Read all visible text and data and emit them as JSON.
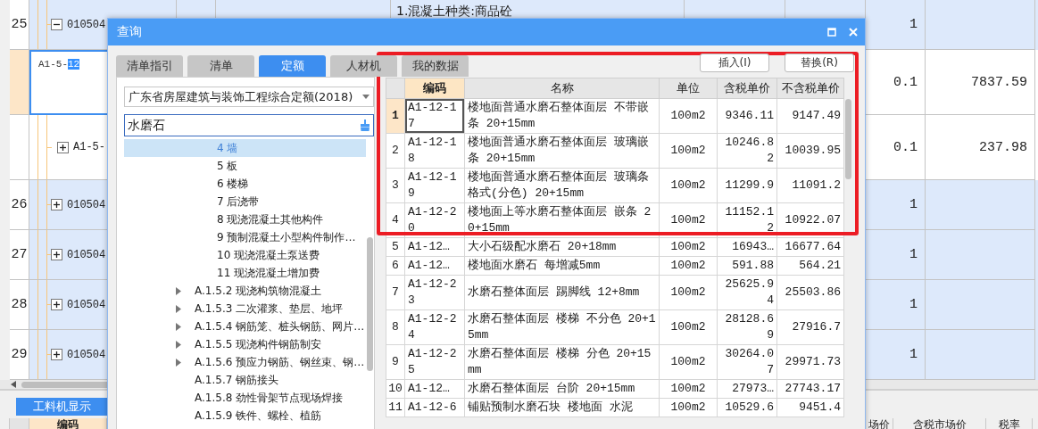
{
  "sheet": {
    "rows": [
      {
        "kind": "group",
        "index": "25",
        "expanded": true,
        "code": "010504",
        "description": "1.混凝土种类:商品砼",
        "quantity": "1",
        "selected": false
      },
      {
        "kind": "editing",
        "code": "A1-5-",
        "code_selection": "12",
        "quantity": "0.1",
        "amount": "7837.59",
        "selected": true
      },
      {
        "kind": "item",
        "expanded": false,
        "code": "A1-5-",
        "quantity": "0.1",
        "amount": "237.98",
        "selected": false
      },
      {
        "kind": "group",
        "index": "26",
        "expanded": false,
        "code": "010504",
        "quantity": "1",
        "selected": false
      },
      {
        "kind": "group",
        "index": "27",
        "expanded": false,
        "code": "010504",
        "quantity": "1",
        "selected": false
      },
      {
        "kind": "group",
        "index": "28",
        "expanded": false,
        "code": "010504",
        "quantity": "1",
        "selected": false
      },
      {
        "kind": "group",
        "index": "29",
        "expanded": false,
        "code": "010504",
        "quantity": "1",
        "selected": false
      }
    ]
  },
  "detail_panel": {
    "button": "工料机显示",
    "columns": [
      {
        "label": "编码"
      },
      {
        "label": "场价"
      },
      {
        "label": "含税市场价"
      },
      {
        "label": "税率"
      }
    ]
  },
  "dialog": {
    "title": "查询",
    "tabs": [
      {
        "label": "清单指引",
        "selected": false
      },
      {
        "label": "清单",
        "selected": false
      },
      {
        "label": "定额",
        "selected": true
      },
      {
        "label": "人材机",
        "selected": false
      },
      {
        "label": "我的数据",
        "selected": false
      }
    ],
    "buttons": [
      "插入(I)",
      "替换(R)"
    ],
    "library": "广东省房屋建筑与装饰工程综合定额(2018)",
    "search": "水磨石",
    "tree": [
      {
        "children": [
          {
            "label": "4 墙",
            "expandable": false,
            "selected": true
          },
          {
            "label": "5 板",
            "expandable": false,
            "selected": false
          },
          {
            "label": "6 楼梯",
            "expandable": false,
            "selected": false
          },
          {
            "label": "7 后浇带",
            "expandable": false,
            "selected": false
          },
          {
            "label": "8 现浇混凝土其他构件",
            "expandable": false,
            "selected": false
          },
          {
            "label": "9 预制混凝土小型构件制作…",
            "expandable": false,
            "selected": false
          },
          {
            "label": "10 现浇混凝土泵送费",
            "expandable": false,
            "selected": false
          },
          {
            "label": "11 现浇混凝土增加费",
            "expandable": false,
            "selected": false
          }
        ]
      },
      {
        "label": "A.1.5.2 现浇构筑物混凝土",
        "expandable": true,
        "selected": false
      },
      {
        "label": "A.1.5.3 二次灌浆、垫层、地坪",
        "expandable": true,
        "selected": false
      },
      {
        "label": "A.1.5.4 钢筋笼、桩头钢筋、网片…",
        "expandable": true,
        "selected": false
      },
      {
        "label": "A.1.5.5 现浇构件钢筋制安",
        "expandable": true,
        "selected": false
      },
      {
        "label": "A.1.5.6 预应力钢筋、钢丝束、钢…",
        "expandable": true,
        "selected": false
      },
      {
        "label": "A.1.5.7 钢筋接头",
        "expandable": false,
        "selected": false
      },
      {
        "label": "A.1.5.8 劲性骨架节点现场焊接",
        "expandable": false,
        "selected": false
      },
      {
        "label": "A.1.5.9 铁件、螺栓、植筋",
        "expandable": false,
        "selected": false
      }
    ],
    "table": {
      "columns": [
        "",
        "编码",
        "名称",
        "单位",
        "含税单价",
        "不含税单价"
      ],
      "rows": [
        {
          "index": "1",
          "code": "A1-12-17",
          "name": "楼地面普通水磨石整体面层 不带嵌条 20+15mm",
          "unit": "100m2",
          "price_with_tax": "9346.11",
          "price_without_tax": "9147.49",
          "selected": true
        },
        {
          "index": "2",
          "code": "A1-12-18",
          "name": "楼地面普通水磨石整体面层 玻璃嵌条 20+15mm",
          "unit": "100m2",
          "price_with_tax": "10246.82",
          "price_without_tax": "10039.95",
          "selected": false
        },
        {
          "index": "3",
          "code": "A1-12-19",
          "name": "楼地面普通水磨石整体面层 玻璃条格式(分色) 20+15mm",
          "unit": "100m2",
          "price_with_tax": "11299.9",
          "price_without_tax": "11091.2",
          "selected": false
        },
        {
          "index": "4",
          "code": "A1-12-20",
          "name": "楼地面上等水磨石整体面层 嵌条 20+15mm",
          "unit": "100m2",
          "price_with_tax": "11152.12",
          "price_without_tax": "10922.07",
          "selected": false
        },
        {
          "index": "5",
          "code": "A1-12…",
          "name": "大小石级配水磨石 20+18mm",
          "unit": "100m2",
          "price_with_tax": "16943…",
          "price_without_tax": "16677.64",
          "selected": false
        },
        {
          "index": "6",
          "code": "A1-12…",
          "name": "楼地面水磨石 每增减5mm",
          "unit": "100m2",
          "price_with_tax": "591.88",
          "price_without_tax": "564.21",
          "selected": false
        },
        {
          "index": "7",
          "code": "A1-12-23",
          "name": "水磨石整体面层 踢脚线 12+8mm",
          "unit": "100m2",
          "price_with_tax": "25625.94",
          "price_without_tax": "25503.86",
          "selected": false
        },
        {
          "index": "8",
          "code": "A1-12-24",
          "name": "水磨石整体面层 楼梯 不分色 20+15mm",
          "unit": "100m2",
          "price_with_tax": "28128.69",
          "price_without_tax": "27916.7",
          "selected": false
        },
        {
          "index": "9",
          "code": "A1-12-25",
          "name": "水磨石整体面层 楼梯 分色 20+15mm",
          "unit": "100m2",
          "price_with_tax": "30264.07",
          "price_without_tax": "29971.73",
          "selected": false
        },
        {
          "index": "10",
          "code": "A1-12…",
          "name": "水磨石整体面层 台阶 20+15mm",
          "unit": "100m2",
          "price_with_tax": "27973…",
          "price_without_tax": "27743.17",
          "selected": false
        },
        {
          "index": "11",
          "code": "A1-12-6",
          "name": "铺贴预制水磨石块 楼地面 水泥",
          "unit": "100m2",
          "price_with_tax": "10529.6",
          "price_without_tax": "9451.4",
          "selected": false
        }
      ]
    }
  }
}
